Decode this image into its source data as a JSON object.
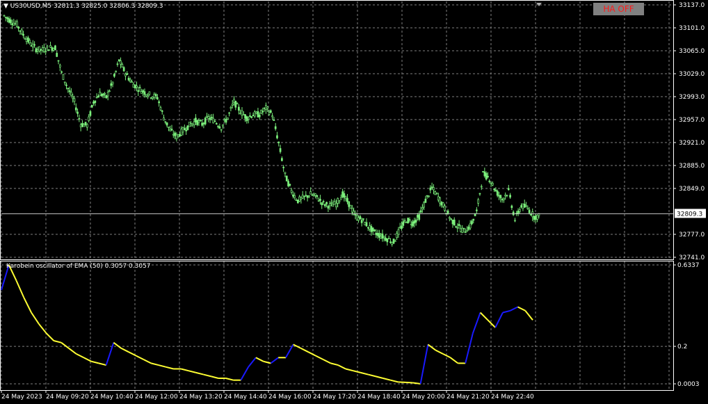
{
  "header": {
    "menu_arrow": "▼",
    "symbol_timeframe": "US30USD,M5",
    "ohlc": "32811.3 32825.0 32806.3 32809.3"
  },
  "ha_button": {
    "label": "HA OFF"
  },
  "price_axis": {
    "ticks": [
      "33137.0",
      "33101.0",
      "33065.0",
      "33029.0",
      "32993.0",
      "32957.0",
      "32921.0",
      "32885.0",
      "32849.0",
      "32777.0",
      "32741.0"
    ],
    "current_price": "32809.3"
  },
  "oscillator": {
    "title": "Karobein oscillator of EMA (50) 0.3057 0.3057",
    "ticks": [
      "0.6337",
      "0.2",
      "0.0003"
    ]
  },
  "time_axis": {
    "labels": [
      "24 May 2023",
      "24 May 09:20",
      "24 May 10:40",
      "24 May 12:00",
      "24 May 13:20",
      "24 May 14:40",
      "24 May 16:00",
      "24 May 17:20",
      "24 May 18:40",
      "24 May 20:00",
      "24 May 21:20",
      "24 May 22:40"
    ]
  },
  "colors": {
    "background": "#000000",
    "grid": "#7f7f7f",
    "candles": "#7cf07c",
    "osc_up": "#1a1aff",
    "osc_down": "#ffff33",
    "ha_text": "#ff1a1a",
    "ha_bg": "#808080"
  },
  "chart_data": [
    {
      "type": "candlestick",
      "title": "US30USD,M5",
      "ylim": [
        32741,
        33137
      ],
      "x_labels": [
        "24 May 2023",
        "24 May 09:20",
        "24 May 10:40",
        "24 May 12:00",
        "24 May 13:20",
        "24 May 14:40",
        "24 May 16:00",
        "24 May 17:20",
        "24 May 18:40",
        "24 May 20:00",
        "24 May 21:20",
        "24 May 22:40"
      ],
      "close_path": [
        [
          "24 May 2023",
          33120
        ],
        [
          "",
          33112
        ],
        [
          "",
          33106
        ],
        [
          "",
          33090
        ],
        [
          "",
          33078
        ],
        [
          "",
          33068
        ],
        [
          "",
          33066
        ],
        [
          "",
          33070
        ],
        [
          "24 May 09:20",
          33070
        ],
        [
          "",
          33030
        ],
        [
          "",
          33006
        ],
        [
          "",
          32985
        ],
        [
          "",
          32950
        ],
        [
          "",
          32948
        ],
        [
          "",
          32985
        ],
        [
          "",
          32998
        ],
        [
          "24 May 10:40",
          32992
        ],
        [
          "",
          33015
        ],
        [
          "",
          33050
        ],
        [
          "",
          33030
        ],
        [
          "",
          33015
        ],
        [
          "",
          33006
        ],
        [
          "",
          33000
        ],
        [
          "",
          32995
        ],
        [
          "24 May 12:00",
          32992
        ],
        [
          "",
          32960
        ],
        [
          "",
          32940
        ],
        [
          "",
          32930
        ],
        [
          "",
          32940
        ],
        [
          "",
          32948
        ],
        [
          "",
          32955
        ],
        [
          "",
          32950
        ],
        [
          "24 May 13:20",
          32960
        ],
        [
          "",
          32955
        ],
        [
          "",
          32945
        ],
        [
          "",
          32960
        ],
        [
          "",
          32985
        ],
        [
          "",
          32970
        ],
        [
          "",
          32960
        ],
        [
          "",
          32965
        ],
        [
          "24 May 14:40",
          32965
        ],
        [
          "",
          32975
        ],
        [
          "",
          32965
        ],
        [
          "",
          32920
        ],
        [
          "",
          32870
        ],
        [
          "",
          32845
        ],
        [
          "",
          32830
        ],
        [
          "",
          32835
        ],
        [
          "24 May 16:00",
          32840
        ],
        [
          "",
          32835
        ],
        [
          "",
          32825
        ],
        [
          "",
          32822
        ],
        [
          "",
          32825
        ],
        [
          "",
          32840
        ],
        [
          "",
          32825
        ],
        [
          "",
          32805
        ],
        [
          "24 May 17:20",
          32800
        ],
        [
          "",
          32790
        ],
        [
          "",
          32780
        ],
        [
          "",
          32775
        ],
        [
          "",
          32770
        ],
        [
          "",
          32765
        ],
        [
          "",
          32785
        ],
        [
          "",
          32800
        ],
        [
          "24 May 18:40",
          32795
        ],
        [
          "",
          32805
        ],
        [
          "",
          32830
        ],
        [
          "",
          32850
        ],
        [
          "",
          32835
        ],
        [
          "",
          32818
        ],
        [
          "",
          32800
        ],
        [
          "",
          32790
        ],
        [
          "24 May 20:00",
          32782
        ],
        [
          "",
          32790
        ],
        [
          "",
          32812
        ],
        [
          "",
          32872
        ],
        [
          "",
          32865
        ],
        [
          "",
          32845
        ],
        [
          "",
          32832
        ],
        [
          "",
          32845
        ],
        [
          "24 May 21:20",
          32800
        ],
        [
          "",
          32822
        ],
        [
          "",
          32818
        ],
        [
          "",
          32805
        ]
      ]
    },
    {
      "type": "line",
      "title": "Karobein oscillator of EMA (50) 0.3057 0.3057",
      "ylim": [
        0.0003,
        0.6337
      ],
      "series": [
        {
          "values": [
            [
              "24 May 2023",
              0.5
            ],
            [
              "",
              0.6337
            ],
            [
              "",
              0.55
            ],
            [
              "",
              0.46
            ],
            [
              "",
              0.38
            ],
            [
              "",
              0.32
            ],
            [
              "",
              0.27
            ],
            [
              "",
              0.23
            ],
            [
              "24 May 09:20",
              0.22
            ],
            [
              "",
              0.19
            ],
            [
              "",
              0.16
            ],
            [
              "",
              0.14
            ],
            [
              "",
              0.12
            ],
            [
              "",
              0.11
            ],
            [
              "",
              0.1
            ],
            [
              "",
              0.22
            ],
            [
              "24 May 10:40",
              0.19
            ],
            [
              "",
              0.17
            ],
            [
              "",
              0.15
            ],
            [
              "",
              0.13
            ],
            [
              "",
              0.11
            ],
            [
              "",
              0.1
            ],
            [
              "",
              0.09
            ],
            [
              "",
              0.08
            ],
            [
              "24 May 12:00",
              0.08
            ],
            [
              "",
              0.07
            ],
            [
              "",
              0.06
            ],
            [
              "",
              0.05
            ],
            [
              "",
              0.04
            ],
            [
              "",
              0.03
            ],
            [
              "",
              0.03
            ],
            [
              "",
              0.02
            ],
            [
              "24 May 13:20",
              0.02
            ],
            [
              "",
              0.09
            ],
            [
              "",
              0.14
            ],
            [
              "",
              0.12
            ],
            [
              "",
              0.11
            ],
            [
              "",
              0.14
            ],
            [
              "",
              0.14
            ],
            [
              "",
              0.21
            ],
            [
              "24 May 14:40",
              0.19
            ],
            [
              "",
              0.17
            ],
            [
              "",
              0.15
            ],
            [
              "",
              0.13
            ],
            [
              "",
              0.11
            ],
            [
              "",
              0.1
            ],
            [
              "",
              0.08
            ],
            [
              "",
              0.07
            ],
            [
              "24 May 16:00",
              0.06
            ],
            [
              "",
              0.05
            ],
            [
              "",
              0.04
            ],
            [
              "",
              0.03
            ],
            [
              "",
              0.02
            ],
            [
              "",
              0.01
            ],
            [
              "",
              0.008
            ],
            [
              "",
              0.006
            ],
            [
              "24 May 17:20",
              0.0003
            ],
            [
              "",
              0.21
            ],
            [
              "",
              0.18
            ],
            [
              "",
              0.16
            ],
            [
              "",
              0.14
            ],
            [
              "",
              0.11
            ],
            [
              "",
              0.11
            ],
            [
              "",
              0.27
            ],
            [
              "24 May 18:40",
              0.38
            ],
            [
              "",
              0.34
            ],
            [
              "",
              0.3
            ],
            [
              "",
              0.38
            ],
            [
              "",
              0.39
            ],
            [
              "",
              0.41
            ],
            [
              "",
              0.39
            ],
            [
              "",
              0.34
            ]
          ]
        }
      ]
    }
  ]
}
